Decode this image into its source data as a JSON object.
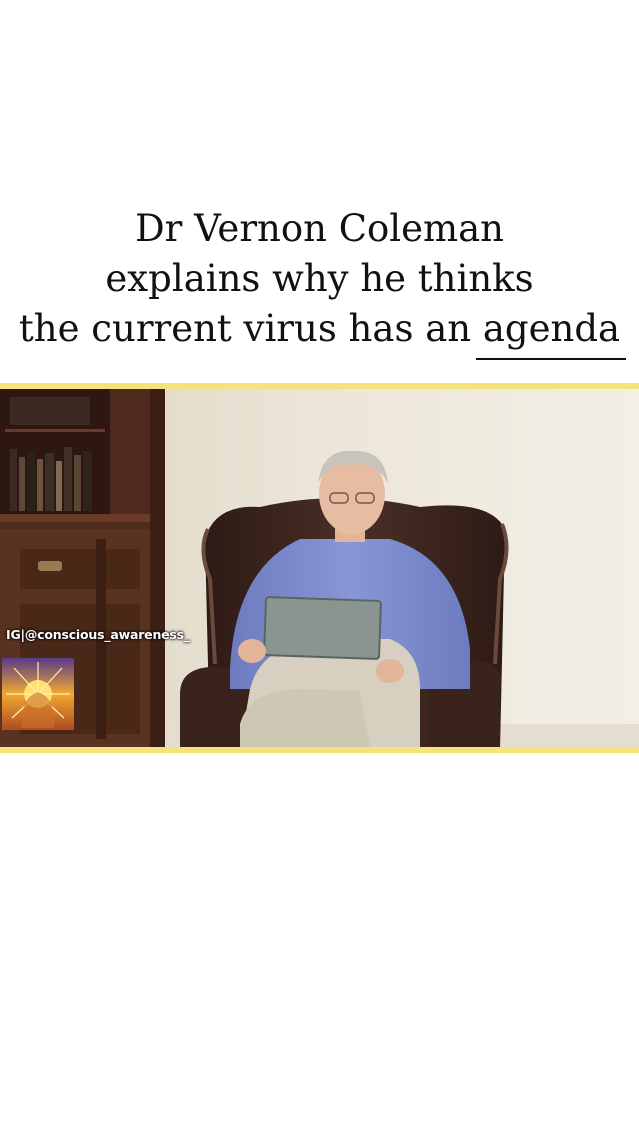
{
  "caption": {
    "line1": "Dr Vernon Coleman",
    "line2": "explains why he thinks",
    "line3_prefix": "the current virus has an ",
    "line3_underlined": "agenda"
  },
  "video": {
    "watermark": "IG|@conscious_awareness_"
  },
  "colors": {
    "accent_band": "#f5e27a",
    "wall": "#ece6d8",
    "shirt": "#7f8fd0",
    "chair": "#3d2620",
    "bookcase": "#4d2a1c"
  }
}
